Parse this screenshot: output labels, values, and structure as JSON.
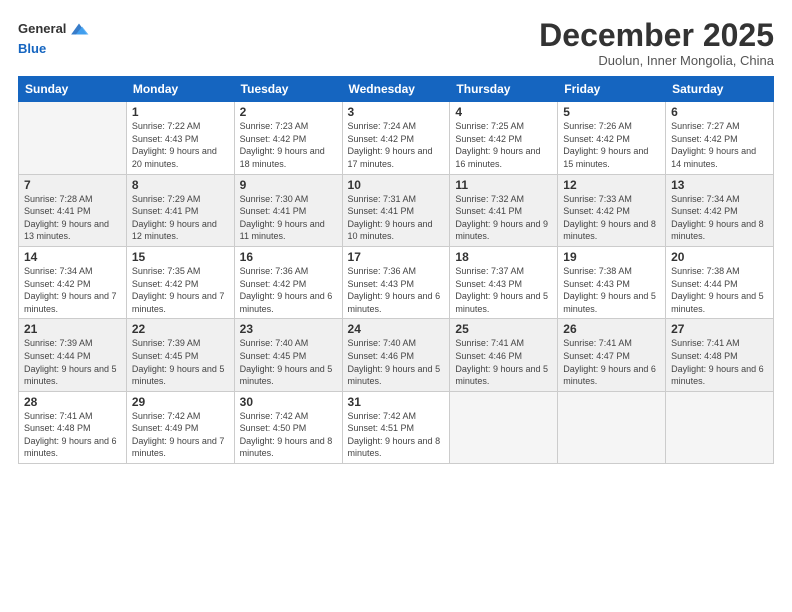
{
  "logo": {
    "general": "General",
    "blue": "Blue"
  },
  "header": {
    "month": "December 2025",
    "location": "Duolun, Inner Mongolia, China"
  },
  "weekdays": [
    "Sunday",
    "Monday",
    "Tuesday",
    "Wednesday",
    "Thursday",
    "Friday",
    "Saturday"
  ],
  "weeks": [
    [
      {
        "day": "",
        "sunrise": "",
        "sunset": "",
        "daylight": ""
      },
      {
        "day": "1",
        "sunrise": "Sunrise: 7:22 AM",
        "sunset": "Sunset: 4:43 PM",
        "daylight": "Daylight: 9 hours and 20 minutes."
      },
      {
        "day": "2",
        "sunrise": "Sunrise: 7:23 AM",
        "sunset": "Sunset: 4:42 PM",
        "daylight": "Daylight: 9 hours and 18 minutes."
      },
      {
        "day": "3",
        "sunrise": "Sunrise: 7:24 AM",
        "sunset": "Sunset: 4:42 PM",
        "daylight": "Daylight: 9 hours and 17 minutes."
      },
      {
        "day": "4",
        "sunrise": "Sunrise: 7:25 AM",
        "sunset": "Sunset: 4:42 PM",
        "daylight": "Daylight: 9 hours and 16 minutes."
      },
      {
        "day": "5",
        "sunrise": "Sunrise: 7:26 AM",
        "sunset": "Sunset: 4:42 PM",
        "daylight": "Daylight: 9 hours and 15 minutes."
      },
      {
        "day": "6",
        "sunrise": "Sunrise: 7:27 AM",
        "sunset": "Sunset: 4:42 PM",
        "daylight": "Daylight: 9 hours and 14 minutes."
      }
    ],
    [
      {
        "day": "7",
        "sunrise": "Sunrise: 7:28 AM",
        "sunset": "Sunset: 4:41 PM",
        "daylight": "Daylight: 9 hours and 13 minutes."
      },
      {
        "day": "8",
        "sunrise": "Sunrise: 7:29 AM",
        "sunset": "Sunset: 4:41 PM",
        "daylight": "Daylight: 9 hours and 12 minutes."
      },
      {
        "day": "9",
        "sunrise": "Sunrise: 7:30 AM",
        "sunset": "Sunset: 4:41 PM",
        "daylight": "Daylight: 9 hours and 11 minutes."
      },
      {
        "day": "10",
        "sunrise": "Sunrise: 7:31 AM",
        "sunset": "Sunset: 4:41 PM",
        "daylight": "Daylight: 9 hours and 10 minutes."
      },
      {
        "day": "11",
        "sunrise": "Sunrise: 7:32 AM",
        "sunset": "Sunset: 4:41 PM",
        "daylight": "Daylight: 9 hours and 9 minutes."
      },
      {
        "day": "12",
        "sunrise": "Sunrise: 7:33 AM",
        "sunset": "Sunset: 4:42 PM",
        "daylight": "Daylight: 9 hours and 8 minutes."
      },
      {
        "day": "13",
        "sunrise": "Sunrise: 7:34 AM",
        "sunset": "Sunset: 4:42 PM",
        "daylight": "Daylight: 9 hours and 8 minutes."
      }
    ],
    [
      {
        "day": "14",
        "sunrise": "Sunrise: 7:34 AM",
        "sunset": "Sunset: 4:42 PM",
        "daylight": "Daylight: 9 hours and 7 minutes."
      },
      {
        "day": "15",
        "sunrise": "Sunrise: 7:35 AM",
        "sunset": "Sunset: 4:42 PM",
        "daylight": "Daylight: 9 hours and 7 minutes."
      },
      {
        "day": "16",
        "sunrise": "Sunrise: 7:36 AM",
        "sunset": "Sunset: 4:42 PM",
        "daylight": "Daylight: 9 hours and 6 minutes."
      },
      {
        "day": "17",
        "sunrise": "Sunrise: 7:36 AM",
        "sunset": "Sunset: 4:43 PM",
        "daylight": "Daylight: 9 hours and 6 minutes."
      },
      {
        "day": "18",
        "sunrise": "Sunrise: 7:37 AM",
        "sunset": "Sunset: 4:43 PM",
        "daylight": "Daylight: 9 hours and 5 minutes."
      },
      {
        "day": "19",
        "sunrise": "Sunrise: 7:38 AM",
        "sunset": "Sunset: 4:43 PM",
        "daylight": "Daylight: 9 hours and 5 minutes."
      },
      {
        "day": "20",
        "sunrise": "Sunrise: 7:38 AM",
        "sunset": "Sunset: 4:44 PM",
        "daylight": "Daylight: 9 hours and 5 minutes."
      }
    ],
    [
      {
        "day": "21",
        "sunrise": "Sunrise: 7:39 AM",
        "sunset": "Sunset: 4:44 PM",
        "daylight": "Daylight: 9 hours and 5 minutes."
      },
      {
        "day": "22",
        "sunrise": "Sunrise: 7:39 AM",
        "sunset": "Sunset: 4:45 PM",
        "daylight": "Daylight: 9 hours and 5 minutes."
      },
      {
        "day": "23",
        "sunrise": "Sunrise: 7:40 AM",
        "sunset": "Sunset: 4:45 PM",
        "daylight": "Daylight: 9 hours and 5 minutes."
      },
      {
        "day": "24",
        "sunrise": "Sunrise: 7:40 AM",
        "sunset": "Sunset: 4:46 PM",
        "daylight": "Daylight: 9 hours and 5 minutes."
      },
      {
        "day": "25",
        "sunrise": "Sunrise: 7:41 AM",
        "sunset": "Sunset: 4:46 PM",
        "daylight": "Daylight: 9 hours and 5 minutes."
      },
      {
        "day": "26",
        "sunrise": "Sunrise: 7:41 AM",
        "sunset": "Sunset: 4:47 PM",
        "daylight": "Daylight: 9 hours and 6 minutes."
      },
      {
        "day": "27",
        "sunrise": "Sunrise: 7:41 AM",
        "sunset": "Sunset: 4:48 PM",
        "daylight": "Daylight: 9 hours and 6 minutes."
      }
    ],
    [
      {
        "day": "28",
        "sunrise": "Sunrise: 7:41 AM",
        "sunset": "Sunset: 4:48 PM",
        "daylight": "Daylight: 9 hours and 6 minutes."
      },
      {
        "day": "29",
        "sunrise": "Sunrise: 7:42 AM",
        "sunset": "Sunset: 4:49 PM",
        "daylight": "Daylight: 9 hours and 7 minutes."
      },
      {
        "day": "30",
        "sunrise": "Sunrise: 7:42 AM",
        "sunset": "Sunset: 4:50 PM",
        "daylight": "Daylight: 9 hours and 8 minutes."
      },
      {
        "day": "31",
        "sunrise": "Sunrise: 7:42 AM",
        "sunset": "Sunset: 4:51 PM",
        "daylight": "Daylight: 9 hours and 8 minutes."
      },
      {
        "day": "",
        "sunrise": "",
        "sunset": "",
        "daylight": ""
      },
      {
        "day": "",
        "sunrise": "",
        "sunset": "",
        "daylight": ""
      },
      {
        "day": "",
        "sunrise": "",
        "sunset": "",
        "daylight": ""
      }
    ]
  ]
}
